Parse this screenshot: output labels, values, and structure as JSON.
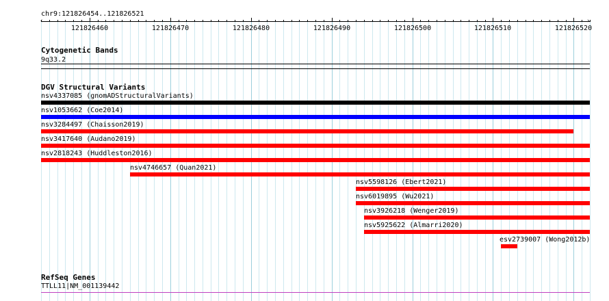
{
  "ruler": {
    "coords_label": "chr9:121826454..121826521",
    "start": 121826454,
    "end": 121826521,
    "tick_labels": [
      "121826460",
      "121826470",
      "121826480",
      "121826490",
      "121826500",
      "121826510",
      "121826520"
    ]
  },
  "cytobands": {
    "title": "Cytogenetic Bands",
    "band": "9q33.2"
  },
  "dgv": {
    "title": "DGV Structural Variants",
    "features": [
      {
        "label": "nsv4337085 (gnomADStructuralVariants)",
        "color": "#000000",
        "start": 121826454,
        "end": 121826521
      },
      {
        "label": "nsv1053662 (Coe2014)",
        "color": "#0000ff",
        "start": 121826454,
        "end": 121826521
      },
      {
        "label": "nsv3284497 (Chaisson2019)",
        "color": "#ff0000",
        "start": 121826454,
        "end": 121826519
      },
      {
        "label": "nsv3417640 (Audano2019)",
        "color": "#ff0000",
        "start": 121826454,
        "end": 121826521
      },
      {
        "label": "nsv2818243 (Huddleston2016)",
        "color": "#ff0000",
        "start": 121826454,
        "end": 121826521
      },
      {
        "label": "nsv4746657 (Quan2021)",
        "color": "#ff0000",
        "start": 121826465,
        "end": 121826521
      },
      {
        "label": "nsv5598126 (Ebert2021)",
        "color": "#ff0000",
        "start": 121826493,
        "end": 121826521
      },
      {
        "label": "nsv6019895 (Wu2021)",
        "color": "#ff0000",
        "start": 121826493,
        "end": 121826521
      },
      {
        "label": "nsv3926218 (Wenger2019)",
        "color": "#ff0000",
        "start": 121826494,
        "end": 121826521
      },
      {
        "label": "nsv5925622 (Almarri2020)",
        "color": "#ff0000",
        "start": 121826494,
        "end": 121826521
      },
      {
        "label": "esv2739007 (Wong2012b)",
        "color": "#ff0000",
        "start": 121826511,
        "end": 121826512
      }
    ]
  },
  "refseq": {
    "title": "RefSeq Genes",
    "gene": "TTLL11|NM_001139442"
  }
}
